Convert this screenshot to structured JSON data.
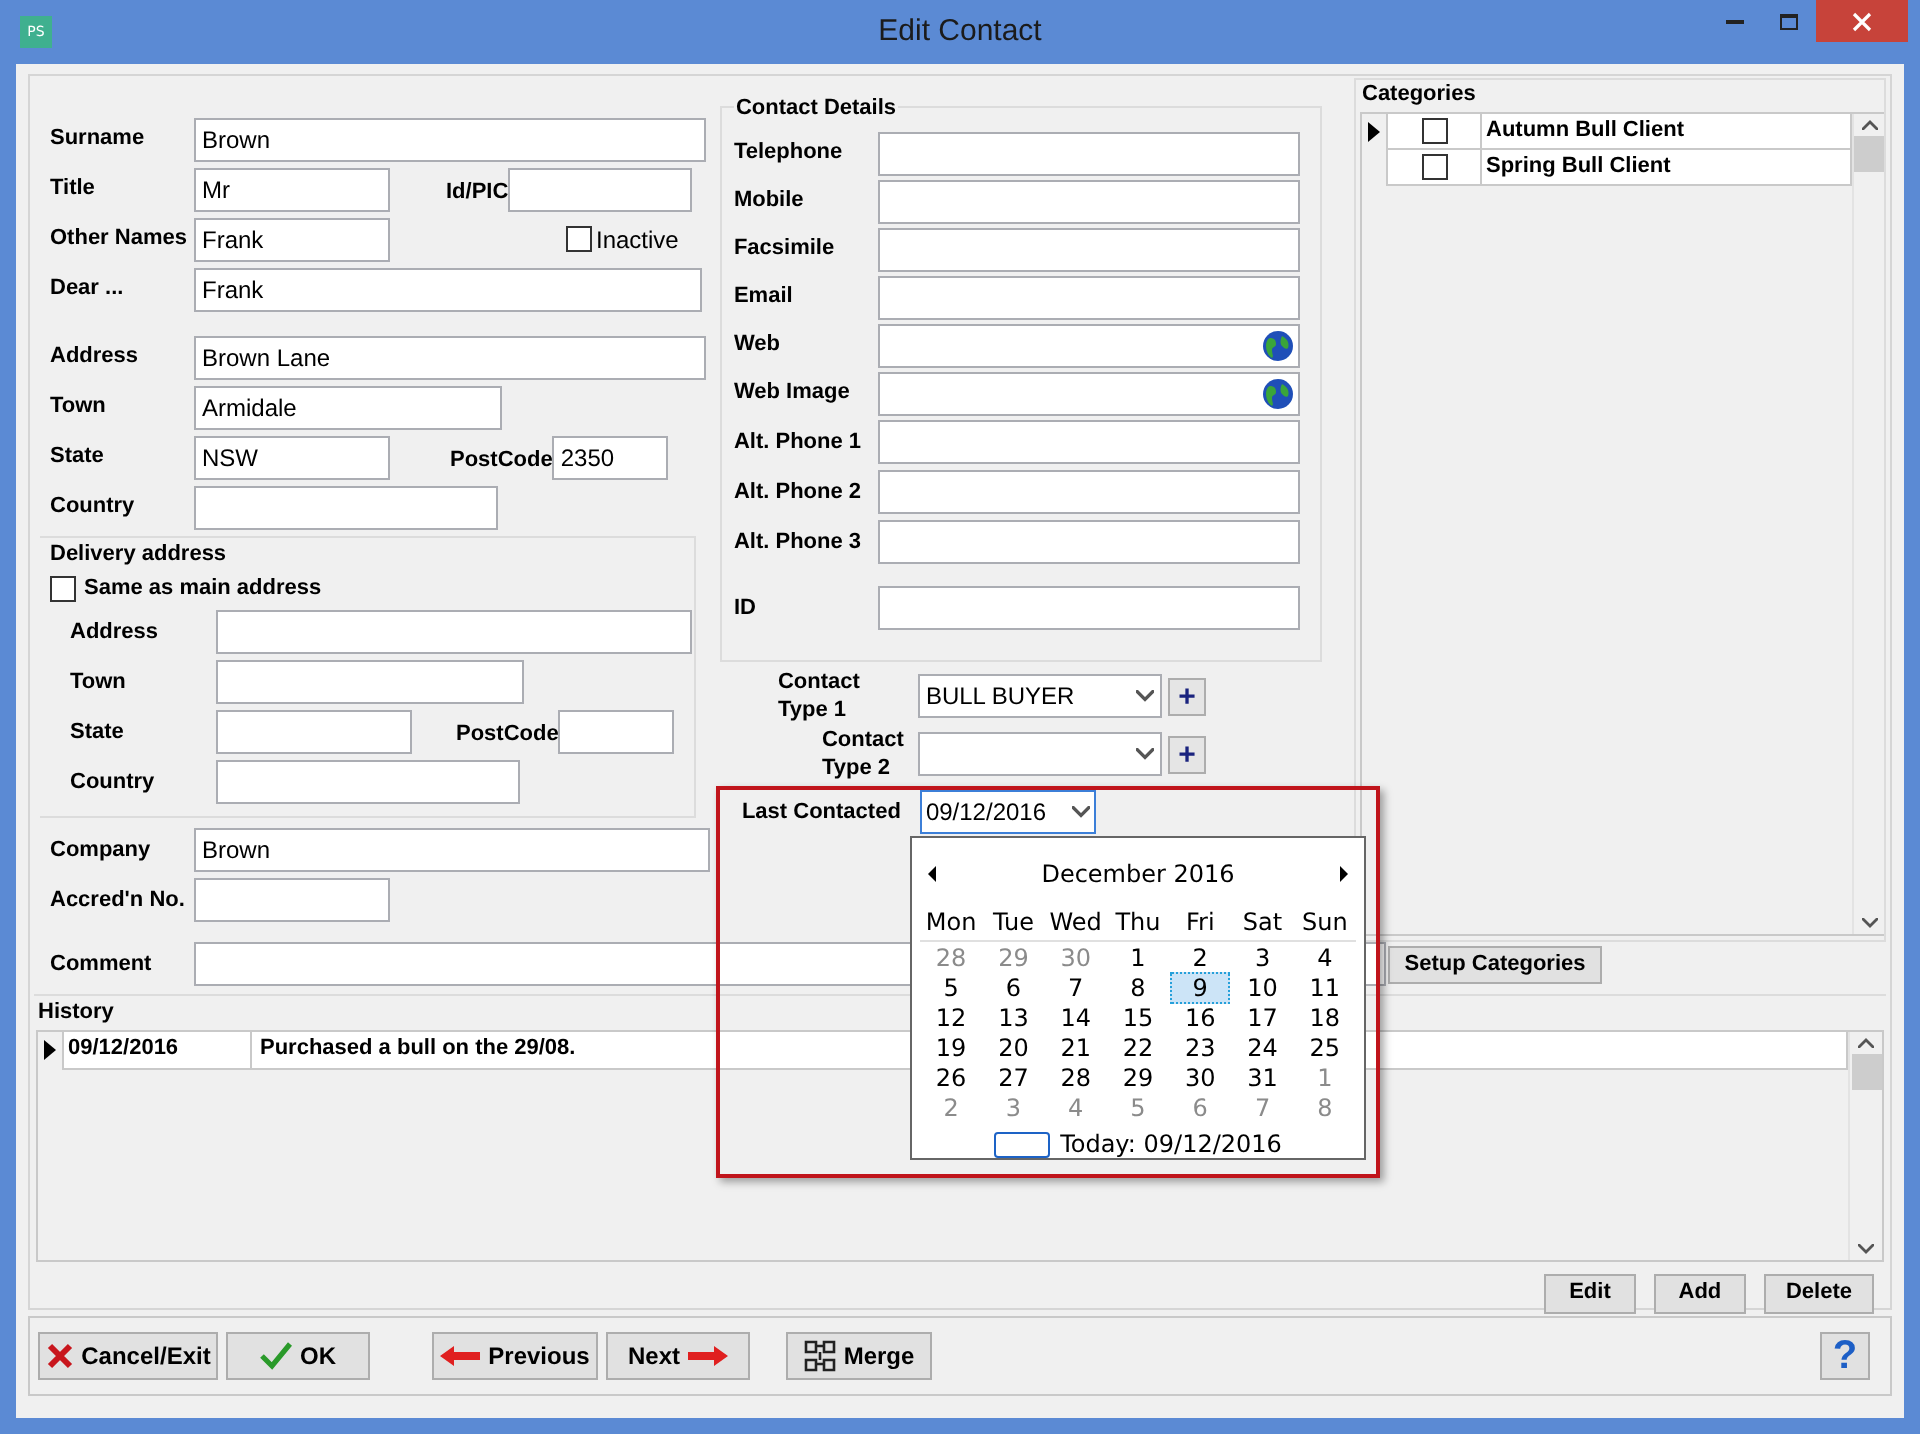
{
  "window": {
    "title": "Edit Contact",
    "app_icon": "PS"
  },
  "contact": {
    "surname": {
      "label": "Surname",
      "value": "Brown"
    },
    "title": {
      "label": "Title",
      "value": "Mr"
    },
    "id_pic": {
      "label": "Id/PIC"
    },
    "other_names": {
      "label": "Other Names",
      "value": "Frank"
    },
    "inactive": {
      "label": "Inactive",
      "checked": false
    },
    "dear": {
      "label": "Dear ...",
      "value": "Frank"
    },
    "address": {
      "label": "Address",
      "value": "Brown Lane"
    },
    "town": {
      "label": "Town",
      "value": "Armidale"
    },
    "state": {
      "label": "State",
      "value": "NSW"
    },
    "postcode": {
      "label": "PostCode",
      "value": "2350"
    },
    "country": {
      "label": "Country"
    }
  },
  "delivery": {
    "title": "Delivery address",
    "same_as_main": {
      "label": "Same as main address",
      "checked": false
    },
    "address": {
      "label": "Address"
    },
    "town": {
      "label": "Town"
    },
    "state": {
      "label": "State"
    },
    "postcode": {
      "label": "PostCode"
    },
    "country": {
      "label": "Country"
    }
  },
  "company": {
    "label": "Company",
    "value": "Brown"
  },
  "accred": {
    "label": "Accred'n No."
  },
  "comment": {
    "label": "Comment"
  },
  "contact_details": {
    "title": "Contact Details",
    "fields": [
      {
        "label": "Telephone",
        "kind": "text"
      },
      {
        "label": "Mobile",
        "kind": "text"
      },
      {
        "label": "Facsimile",
        "kind": "text"
      },
      {
        "label": "Email",
        "kind": "text"
      },
      {
        "label": "Web",
        "kind": "link"
      },
      {
        "label": "Web Image",
        "kind": "link"
      },
      {
        "label": "Alt. Phone 1",
        "kind": "text"
      },
      {
        "label": "Alt. Phone 2",
        "kind": "text"
      },
      {
        "label": "Alt. Phone 3",
        "kind": "text"
      },
      {
        "label": "ID",
        "kind": "text"
      }
    ]
  },
  "contact_types": [
    {
      "label": "Contact Type 1",
      "value": "BULL BUYER",
      "plus": "+"
    },
    {
      "label": "Contact Type 2",
      "plus": "+"
    }
  ],
  "last_contacted": {
    "label": "Last Contacted",
    "value": "09/12/2016",
    "expanded": true
  },
  "calendar": {
    "month": "December 2016",
    "weekdays": [
      "Mon",
      "Tue",
      "Wed",
      "Thu",
      "Fri",
      "Sat",
      "Sun"
    ],
    "today": "Today: 09/12/2016",
    "days": [
      {
        "label": "28",
        "other_month": true,
        "selected": false
      },
      {
        "label": "29",
        "other_month": true,
        "selected": false
      },
      {
        "label": "30",
        "other_month": true,
        "selected": false
      },
      {
        "label": "1",
        "other_month": false,
        "selected": false
      },
      {
        "label": "2",
        "other_month": false,
        "selected": false
      },
      {
        "label": "3",
        "other_month": false,
        "selected": false
      },
      {
        "label": "4",
        "other_month": false,
        "selected": false
      },
      {
        "label": "5",
        "other_month": false,
        "selected": false
      },
      {
        "label": "6",
        "other_month": false,
        "selected": false
      },
      {
        "label": "7",
        "other_month": false,
        "selected": false
      },
      {
        "label": "8",
        "other_month": false,
        "selected": false
      },
      {
        "label": "9",
        "other_month": false,
        "selected": true
      },
      {
        "label": "10",
        "other_month": false,
        "selected": false
      },
      {
        "label": "11",
        "other_month": false,
        "selected": false
      },
      {
        "label": "12",
        "other_month": false,
        "selected": false
      },
      {
        "label": "13",
        "other_month": false,
        "selected": false
      },
      {
        "label": "14",
        "other_month": false,
        "selected": false
      },
      {
        "label": "15",
        "other_month": false,
        "selected": false
      },
      {
        "label": "16",
        "other_month": false,
        "selected": false
      },
      {
        "label": "17",
        "other_month": false,
        "selected": false
      },
      {
        "label": "18",
        "other_month": false,
        "selected": false
      },
      {
        "label": "19",
        "other_month": false,
        "selected": false
      },
      {
        "label": "20",
        "other_month": false,
        "selected": false
      },
      {
        "label": "21",
        "other_month": false,
        "selected": false
      },
      {
        "label": "22",
        "other_month": false,
        "selected": false
      },
      {
        "label": "23",
        "other_month": false,
        "selected": false
      },
      {
        "label": "24",
        "other_month": false,
        "selected": false
      },
      {
        "label": "25",
        "other_month": false,
        "selected": false
      },
      {
        "label": "26",
        "other_month": false,
        "selected": false
      },
      {
        "label": "27",
        "other_month": false,
        "selected": false
      },
      {
        "label": "28",
        "other_month": false,
        "selected": false
      },
      {
        "label": "29",
        "other_month": false,
        "selected": false
      },
      {
        "label": "30",
        "other_month": false,
        "selected": false
      },
      {
        "label": "31",
        "other_month": false,
        "selected": false
      },
      {
        "label": "1",
        "other_month": true,
        "selected": false
      },
      {
        "label": "2",
        "other_month": true,
        "selected": false
      },
      {
        "label": "3",
        "other_month": true,
        "selected": false
      },
      {
        "label": "4",
        "other_month": true,
        "selected": false
      },
      {
        "label": "5",
        "other_month": true,
        "selected": false
      },
      {
        "label": "6",
        "other_month": true,
        "selected": false
      },
      {
        "label": "7",
        "other_month": true,
        "selected": false
      },
      {
        "label": "8",
        "other_month": true,
        "selected": false
      }
    ]
  },
  "categories": {
    "title": "Categories",
    "rows": [
      {
        "label": "Autumn Bull Client",
        "checked": false,
        "current": true
      },
      {
        "label": "Spring Bull Client",
        "checked": false,
        "current": false
      }
    ]
  },
  "setup_categories": "Setup Categories",
  "history": {
    "title": "History",
    "rows": [
      {
        "date": "09/12/2016",
        "text": "Purchased a bull on the 29/08.",
        "current": true
      }
    ]
  },
  "history_buttons": [
    "Edit",
    "Add",
    "Delete"
  ],
  "footer_buttons": [
    {
      "label": "Cancel/Exit",
      "kind": "cancel"
    },
    {
      "label": "OK",
      "kind": "ok"
    },
    {
      "label": "Previous",
      "kind": "previous"
    },
    {
      "label": "Next",
      "kind": "next"
    },
    {
      "label": "Merge",
      "kind": "merge"
    }
  ],
  "help": "?"
}
